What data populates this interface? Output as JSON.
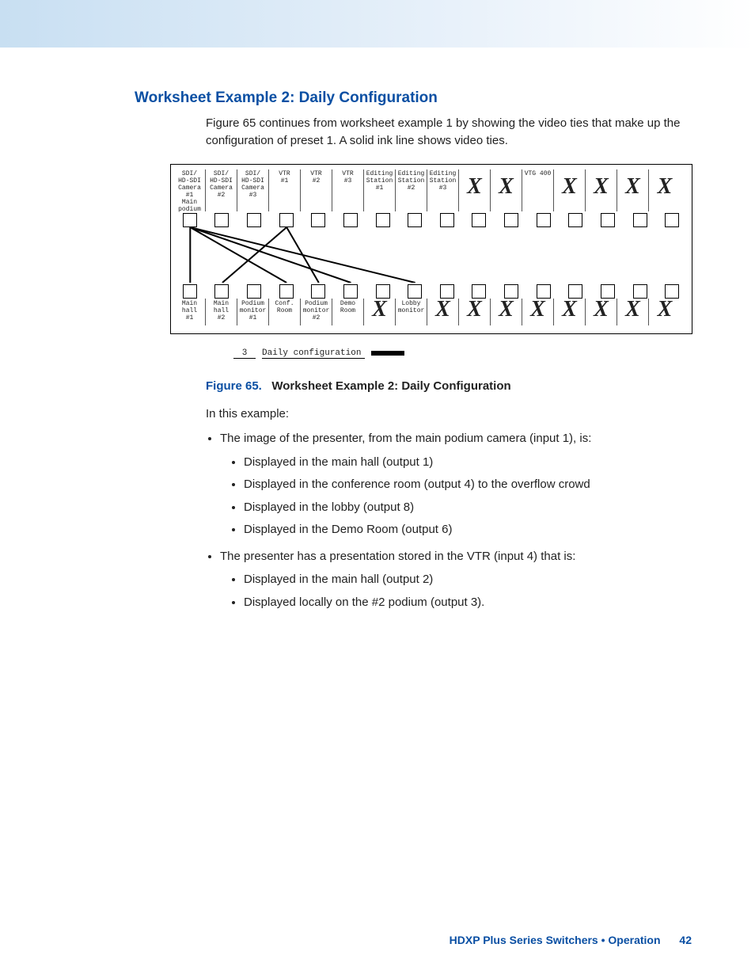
{
  "heading": "Worksheet Example 2: Daily Configuration",
  "intro": "Figure 65 continues from worksheet example 1 by showing the video ties that make up the configuration of preset 1. A solid ink line shows video ties.",
  "figure": {
    "number": "Figure 65.",
    "title": "Worksheet Example 2: Daily Configuration"
  },
  "worksheet": {
    "preset_no": "3",
    "preset_title": "Daily configuration",
    "inputs": [
      "SDI/\nHD-SDI\nCamera #1\nMain\npodium",
      "SDI/\nHD-SDI\nCamera\n#2",
      "SDI/\nHD-SDI\nCamera\n#3",
      "VTR\n#1",
      "VTR\n#2",
      "VTR\n#3",
      "Editing\nStation\n#1",
      "Editing\nStation\n#2",
      "Editing\nStation\n#3",
      "X",
      "X",
      "VTG 400",
      "X",
      "X",
      "X",
      "X"
    ],
    "outputs": [
      "Main hall\n#1",
      "Main hall\n#2",
      "Podium\nmonitor\n#1",
      "Conf.\nRoom",
      "Podium\nmonitor\n#2",
      "Demo\nRoom",
      "X",
      "Lobby\nmonitor",
      "X",
      "X",
      "X",
      "X",
      "X",
      "X",
      "X",
      "X"
    ]
  },
  "example_intro": "In this example:",
  "bullets": [
    {
      "text": "The image of the presenter, from the main podium camera (input 1), is:",
      "sub": [
        "Displayed in the main hall (output 1)",
        "Displayed in the conference room (output 4) to the overflow crowd",
        "Displayed in the lobby (output 8)",
        "Displayed in the Demo Room (output 6)"
      ]
    },
    {
      "text": "The presenter has a presentation stored in the VTR (input 4) that is:",
      "sub": [
        "Displayed in the main hall (output 2)",
        "Displayed locally on the #2 podium (output 3)."
      ]
    }
  ],
  "footer": {
    "title": "HDXP Plus Series Switchers • Operation",
    "page": "42"
  }
}
